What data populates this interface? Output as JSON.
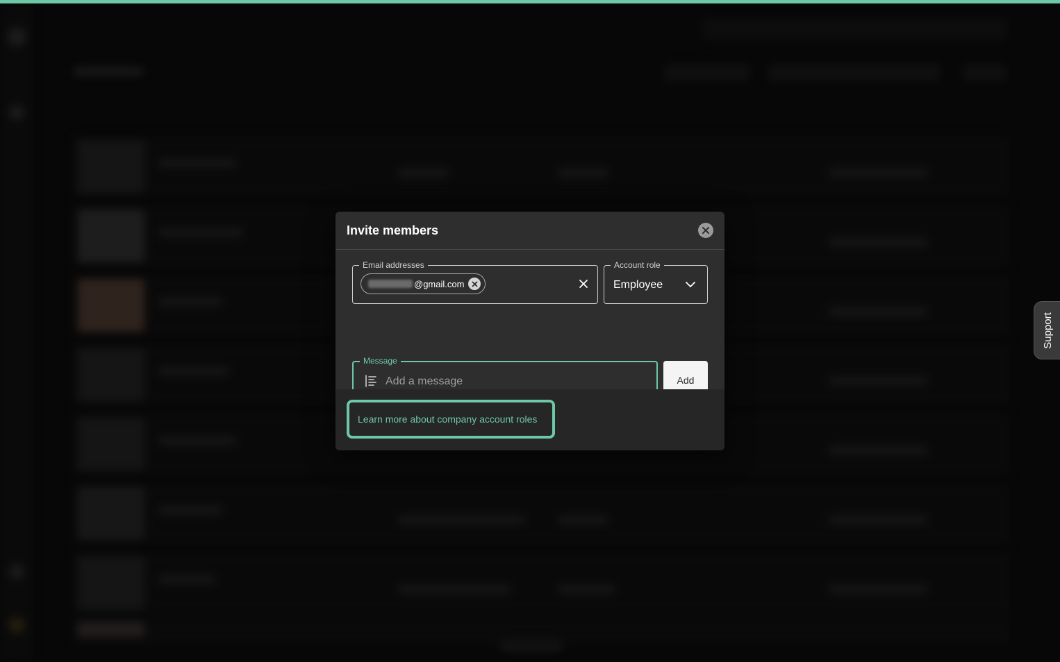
{
  "colors": {
    "accent": "#6cc9a6",
    "modal_background": "#2e2e2e",
    "footer_background": "#262626",
    "backdrop": "#0b0b0b"
  },
  "dialog": {
    "title": "Invite members",
    "close_icon": "close-circle-icon",
    "email_field": {
      "label": "Email addresses",
      "chip_text": "@gmail.com",
      "chip_remove_icon": "close-circle-icon",
      "clear_icon": "close-icon"
    },
    "role_field": {
      "label": "Account role",
      "value": "Employee",
      "dropdown_icon": "chevron-down-icon"
    },
    "message_field": {
      "label": "Message",
      "placeholder": "Add a message",
      "icon": "text-align-icon"
    },
    "add_button": "Add",
    "footer_link": "Learn more about company account roles"
  },
  "support_tab": {
    "label": "Support"
  }
}
